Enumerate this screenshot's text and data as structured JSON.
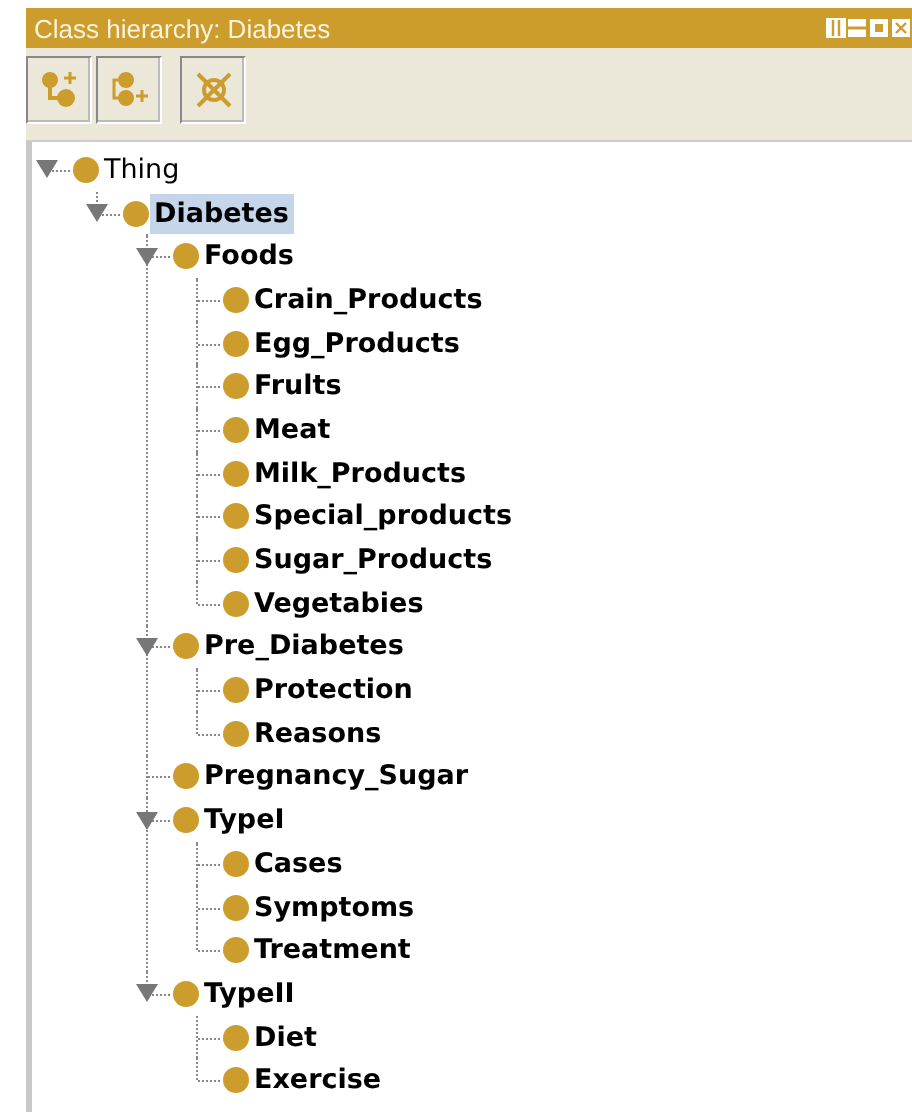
{
  "window": {
    "title": "Class hierarchy: Diabetes"
  },
  "toolbar": [
    {
      "kind": "add_subclass"
    },
    {
      "kind": "add_sibling"
    },
    {
      "kind": "delete"
    }
  ],
  "tree": [
    {
      "label": "Thing",
      "bold": false,
      "selected": false,
      "expanded": true,
      "children": [
        {
          "label": "Diabetes",
          "bold": true,
          "selected": true,
          "expanded": true,
          "children": [
            {
              "label": "Foods",
              "bold": true,
              "selected": false,
              "expanded": true,
              "children": [
                {
                  "label": "Crain_Products",
                  "bold": true,
                  "selected": false
                },
                {
                  "label": "Egg_Products",
                  "bold": true,
                  "selected": false
                },
                {
                  "label": "Frults",
                  "bold": true,
                  "selected": false
                },
                {
                  "label": "Meat",
                  "bold": true,
                  "selected": false
                },
                {
                  "label": "Milk_Products",
                  "bold": true,
                  "selected": false
                },
                {
                  "label": "Special_products",
                  "bold": true,
                  "selected": false
                },
                {
                  "label": "Sugar_Products",
                  "bold": true,
                  "selected": false
                },
                {
                  "label": "Vegetabies",
                  "bold": true,
                  "selected": false
                }
              ]
            },
            {
              "label": "Pre_Diabetes",
              "bold": true,
              "selected": false,
              "expanded": true,
              "children": [
                {
                  "label": "Protection",
                  "bold": true,
                  "selected": false
                },
                {
                  "label": "Reasons",
                  "bold": true,
                  "selected": false
                }
              ]
            },
            {
              "label": "Pregnancy_Sugar",
              "bold": true,
              "selected": false
            },
            {
              "label": "TypeI",
              "bold": true,
              "selected": false,
              "expanded": true,
              "children": [
                {
                  "label": "Cases",
                  "bold": true,
                  "selected": false
                },
                {
                  "label": "Symptoms",
                  "bold": true,
                  "selected": false
                },
                {
                  "label": "Treatment",
                  "bold": true,
                  "selected": false
                }
              ]
            },
            {
              "label": "TypeII",
              "bold": true,
              "selected": false,
              "expanded": true,
              "children": [
                {
                  "label": "Diet",
                  "bold": true,
                  "selected": false
                },
                {
                  "label": "Exercise",
                  "bold": true,
                  "selected": false
                }
              ]
            }
          ]
        }
      ]
    }
  ]
}
